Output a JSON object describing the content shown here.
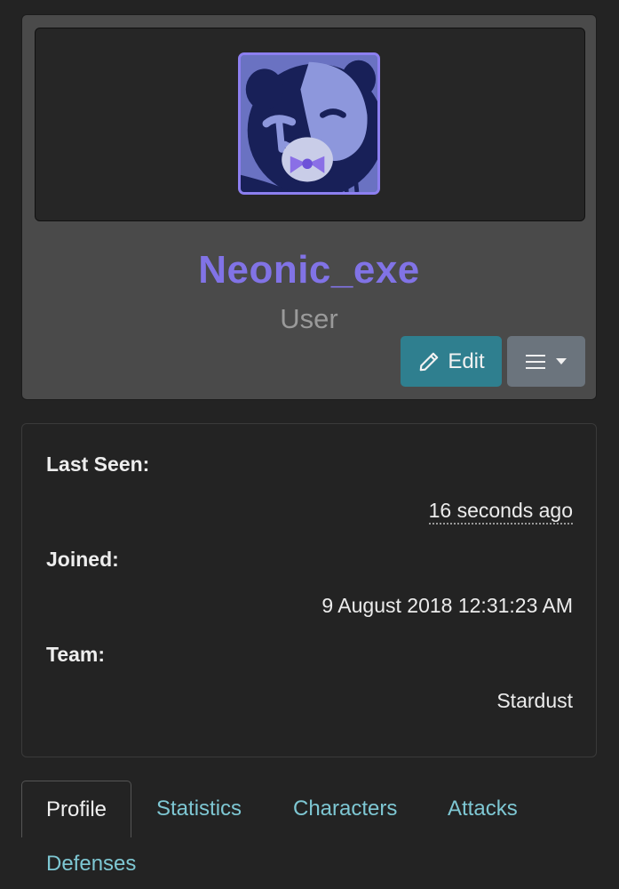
{
  "profile": {
    "username": "Neonic_exe",
    "role": "User",
    "edit_label": "Edit",
    "menu_icon": "hamburger-icon",
    "colors": {
      "username": "#8173e6",
      "avatar_border": "#8c7ff0",
      "edit_button": "#2f7f8f",
      "menu_button": "#6b747d"
    }
  },
  "info": {
    "last_seen_label": "Last Seen:",
    "last_seen_value": "16 seconds ago",
    "joined_label": "Joined:",
    "joined_value": "9 August 2018 12:31:23 AM",
    "team_label": "Team:",
    "team_value": "Stardust"
  },
  "tabs": [
    {
      "label": "Profile",
      "active": true
    },
    {
      "label": "Statistics"
    },
    {
      "label": "Characters"
    },
    {
      "label": "Attacks"
    },
    {
      "label": "Defenses"
    }
  ]
}
